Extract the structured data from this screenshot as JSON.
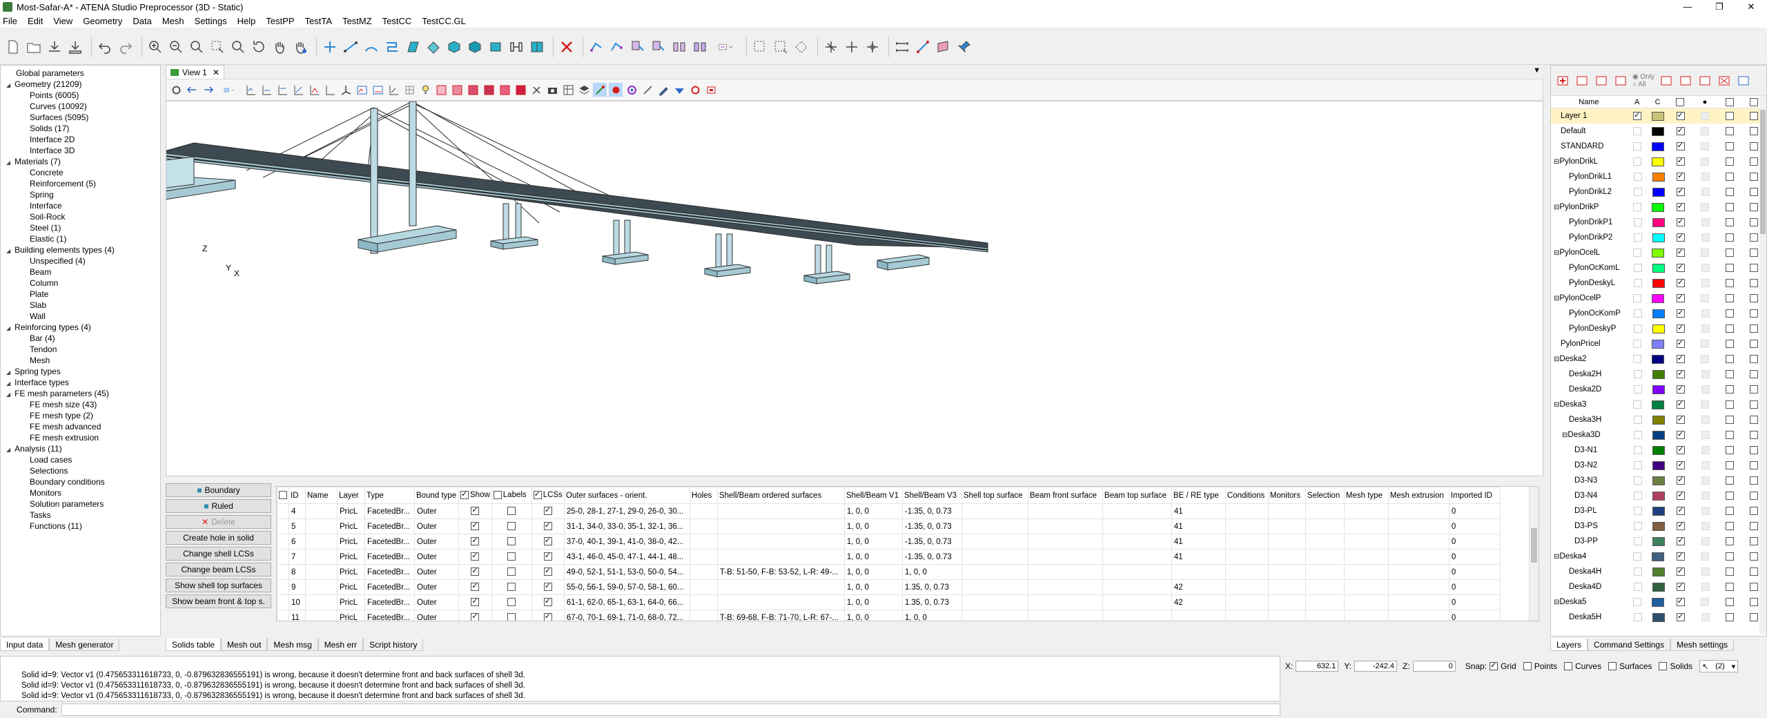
{
  "window": {
    "title": "Most-Safar-A* - ATENA Studio Preprocessor (3D - Static)"
  },
  "menu": [
    "File",
    "Edit",
    "View",
    "Geometry",
    "Data",
    "Mesh",
    "Settings",
    "Help",
    "TestPP",
    "TestTA",
    "TestMZ",
    "TestCC",
    "TestCC.GL"
  ],
  "tree": [
    {
      "label": "Global parameters",
      "level": 0,
      "exp": false
    },
    {
      "label": "Geometry (21209)",
      "level": 0,
      "exp": true
    },
    {
      "label": "Points (6005)",
      "level": 1
    },
    {
      "label": "Curves (10092)",
      "level": 1
    },
    {
      "label": "Surfaces (5095)",
      "level": 1
    },
    {
      "label": "Solids (17)",
      "level": 1
    },
    {
      "label": "Interface 2D",
      "level": 1
    },
    {
      "label": "Interface 3D",
      "level": 1
    },
    {
      "label": "Materials (7)",
      "level": 0,
      "exp": true
    },
    {
      "label": "Concrete",
      "level": 1
    },
    {
      "label": "Reinforcement (5)",
      "level": 1
    },
    {
      "label": "Spring",
      "level": 1
    },
    {
      "label": "Interface",
      "level": 1
    },
    {
      "label": "Soil-Rock",
      "level": 1
    },
    {
      "label": "Steel (1)",
      "level": 1
    },
    {
      "label": "Elastic (1)",
      "level": 1
    },
    {
      "label": "Building elements types (4)",
      "level": 0,
      "exp": true
    },
    {
      "label": "Unspecified (4)",
      "level": 1
    },
    {
      "label": "Beam",
      "level": 1
    },
    {
      "label": "Column",
      "level": 1
    },
    {
      "label": "Plate",
      "level": 1
    },
    {
      "label": "Slab",
      "level": 1
    },
    {
      "label": "Wall",
      "level": 1
    },
    {
      "label": "Reinforcing types (4)",
      "level": 0,
      "exp": true
    },
    {
      "label": "Bar (4)",
      "level": 1
    },
    {
      "label": "Tendon",
      "level": 1
    },
    {
      "label": "Mesh",
      "level": 1
    },
    {
      "label": "Spring types",
      "level": 0,
      "exp": true
    },
    {
      "label": "Interface types",
      "level": 0,
      "exp": true
    },
    {
      "label": "FE mesh parameters (45)",
      "level": 0,
      "exp": true
    },
    {
      "label": "FE mesh size (43)",
      "level": 1
    },
    {
      "label": "FE mesh type (2)",
      "level": 1
    },
    {
      "label": "FE mesh advanced",
      "level": 1
    },
    {
      "label": "FE mesh extrusion",
      "level": 1
    },
    {
      "label": "Analysis (11)",
      "level": 0,
      "exp": true
    },
    {
      "label": "Load cases",
      "level": 1
    },
    {
      "label": "Selections",
      "level": 1
    },
    {
      "label": "Boundary conditions",
      "level": 1
    },
    {
      "label": "Monitors",
      "level": 1
    },
    {
      "label": "Solution parameters",
      "level": 1
    },
    {
      "label": "Tasks",
      "level": 1
    },
    {
      "label": "Functions (11)",
      "level": 1
    }
  ],
  "left_tabs": [
    "Input data",
    "Mesh generator"
  ],
  "view": {
    "tab_label": "View 1",
    "axes": {
      "z": "Z",
      "y": "Y",
      "x": "X"
    }
  },
  "buttons": {
    "boundary": "Boundary",
    "ruled": "Ruled",
    "delete": "Delete",
    "create_hole": "Create hole in solid",
    "change_shell": "Change shell LCSs",
    "change_beam": "Change beam LCSs",
    "show_shell_top": "Show shell top surfaces",
    "show_beam_front": "Show beam front & top s."
  },
  "table": {
    "headers": [
      "ID",
      "Name",
      "Layer",
      "Type",
      "Bound type",
      "Show",
      "Labels",
      "LCSs",
      "Outer surfaces - orient.",
      "Holes",
      "Shell/Beam ordered surfaces",
      "Shell/Beam V1",
      "Shell/Beam V3",
      "Shell top surface",
      "Beam front surface",
      "Beam top surface",
      "BE / RE type",
      "Conditions",
      "Monitors",
      "Selection",
      "Mesh type",
      "Mesh extrusion",
      "Imported ID"
    ],
    "rows": [
      {
        "id": "4",
        "layer": "PricL",
        "type": "FacetedBr...",
        "bound": "Outer",
        "show": true,
        "labels": false,
        "lcs": true,
        "outer": "25-0, 28-1, 27-1, 29-0, 26-0, 30...",
        "ordered": "",
        "v1": "1, 0, 0",
        "v3": "-1.35, 0, 0.73",
        "be": "41",
        "imp": "0"
      },
      {
        "id": "5",
        "layer": "PricL",
        "type": "FacetedBr...",
        "bound": "Outer",
        "show": true,
        "labels": false,
        "lcs": true,
        "outer": "31-1, 34-0, 33-0, 35-1, 32-1, 36...",
        "ordered": "",
        "v1": "1, 0, 0",
        "v3": "-1.35, 0, 0.73",
        "be": "41",
        "imp": "0"
      },
      {
        "id": "6",
        "layer": "PricL",
        "type": "FacetedBr...",
        "bound": "Outer",
        "show": true,
        "labels": false,
        "lcs": true,
        "outer": "37-0, 40-1, 39-1, 41-0, 38-0, 42...",
        "ordered": "",
        "v1": "1, 0, 0",
        "v3": "-1.35, 0, 0.73",
        "be": "41",
        "imp": "0"
      },
      {
        "id": "7",
        "layer": "PricL",
        "type": "FacetedBr...",
        "bound": "Outer",
        "show": true,
        "labels": false,
        "lcs": true,
        "outer": "43-1, 46-0, 45-0, 47-1, 44-1, 48...",
        "ordered": "",
        "v1": "1, 0, 0",
        "v3": "-1.35, 0, 0.73",
        "be": "41",
        "imp": "0"
      },
      {
        "id": "8",
        "layer": "PricL",
        "type": "FacetedBr...",
        "bound": "Outer",
        "show": true,
        "labels": false,
        "lcs": true,
        "outer": "49-0, 52-1, 51-1, 53-0, 50-0, 54...",
        "ordered": "T-B: 51-50, F-B: 53-52, L-R: 49-...",
        "v1": "1, 0, 0",
        "v3": "1, 0, 0",
        "be": "",
        "imp": "0"
      },
      {
        "id": "9",
        "layer": "PricL",
        "type": "FacetedBr...",
        "bound": "Outer",
        "show": true,
        "labels": false,
        "lcs": true,
        "outer": "55-0, 56-1, 59-0, 57-0, 58-1, 60...",
        "ordered": "",
        "v1": "1, 0, 0",
        "v3": "1.35, 0, 0.73",
        "be": "42",
        "imp": "0"
      },
      {
        "id": "10",
        "layer": "PricL",
        "type": "FacetedBr...",
        "bound": "Outer",
        "show": true,
        "labels": false,
        "lcs": true,
        "outer": "61-1, 62-0, 65-1, 63-1, 64-0, 66...",
        "ordered": "",
        "v1": "1, 0, 0",
        "v3": "1.35, 0, 0.73",
        "be": "42",
        "imp": "0"
      },
      {
        "id": "11",
        "layer": "PricL",
        "type": "FacetedBr...",
        "bound": "Outer",
        "show": true,
        "labels": false,
        "lcs": true,
        "outer": "67-0, 70-1, 69-1, 71-0, 68-0, 72...",
        "ordered": "T-B: 69-68, F-B: 71-70, L-R: 67-...",
        "v1": "1, 0, 0",
        "v3": "1, 0, 0",
        "be": "",
        "imp": "0"
      }
    ]
  },
  "bottom_tabs": [
    "Solids table",
    "Mesh out",
    "Mesh msg",
    "Mesh err",
    "Script history"
  ],
  "layers": {
    "headers": [
      "Name",
      "A",
      "C"
    ],
    "radio_only": "Only",
    "radio_all": "All",
    "rows": [
      {
        "name": "Layer 1",
        "indent": 0,
        "active": true,
        "color": "#c8c47a",
        "sel": true
      },
      {
        "name": "Default",
        "indent": 0,
        "active": false,
        "color": "#000000"
      },
      {
        "name": "STANDARD",
        "indent": 0,
        "active": false,
        "color": "#0000ff"
      },
      {
        "name": "PylonDrikL",
        "indent": 0,
        "group": true,
        "active": false,
        "color": "#ffff00"
      },
      {
        "name": "PylonDrikL1",
        "indent": 1,
        "active": false,
        "color": "#ff8000"
      },
      {
        "name": "PylonDrikL2",
        "indent": 1,
        "active": false,
        "color": "#0000ff"
      },
      {
        "name": "PylonDrikP",
        "indent": 0,
        "group": true,
        "active": false,
        "color": "#00ff00"
      },
      {
        "name": "PylonDrikP1",
        "indent": 1,
        "active": false,
        "color": "#ff0080"
      },
      {
        "name": "PylonDrikP2",
        "indent": 1,
        "active": false,
        "color": "#00ffff"
      },
      {
        "name": "PylonOcelL",
        "indent": 0,
        "group": true,
        "active": false,
        "color": "#80ff00"
      },
      {
        "name": "PylonOcKomL",
        "indent": 1,
        "active": false,
        "color": "#00ff80"
      },
      {
        "name": "PylonDeskyL",
        "indent": 1,
        "active": false,
        "color": "#ff0000"
      },
      {
        "name": "PylonOcelP",
        "indent": 0,
        "group": true,
        "active": false,
        "color": "#ff00ff"
      },
      {
        "name": "PylonOcKomP",
        "indent": 1,
        "active": false,
        "color": "#0080ff"
      },
      {
        "name": "PylonDeskyP",
        "indent": 1,
        "active": false,
        "color": "#ffff00"
      },
      {
        "name": "PylonPricel",
        "indent": 0,
        "active": false,
        "color": "#8080ff"
      },
      {
        "name": "Deska2",
        "indent": 0,
        "group": true,
        "active": false,
        "color": "#000080"
      },
      {
        "name": "Deska2H",
        "indent": 1,
        "active": false,
        "color": "#408000"
      },
      {
        "name": "Deska2D",
        "indent": 1,
        "active": false,
        "color": "#8000ff"
      },
      {
        "name": "Deska3",
        "indent": 0,
        "group": true,
        "active": false,
        "color": "#008040"
      },
      {
        "name": "Deska3H",
        "indent": 1,
        "active": false,
        "color": "#808000"
      },
      {
        "name": "Deska3D",
        "indent": 1,
        "group": true,
        "active": false,
        "color": "#004080"
      },
      {
        "name": "D3-N1",
        "indent": 2,
        "active": false,
        "color": "#008000"
      },
      {
        "name": "D3-N2",
        "indent": 2,
        "active": false,
        "color": "#400080"
      },
      {
        "name": "D3-N3",
        "indent": 2,
        "active": false,
        "color": "#6a8040"
      },
      {
        "name": "D3-N4",
        "indent": 2,
        "active": false,
        "color": "#b04060"
      },
      {
        "name": "D3-PL",
        "indent": 2,
        "active": false,
        "color": "#204080"
      },
      {
        "name": "D3-PS",
        "indent": 2,
        "active": false,
        "color": "#806040"
      },
      {
        "name": "D3-PP",
        "indent": 2,
        "active": false,
        "color": "#408060"
      },
      {
        "name": "Deska4",
        "indent": 0,
        "group": true,
        "active": false,
        "color": "#406080"
      },
      {
        "name": "Deska4H",
        "indent": 1,
        "active": false,
        "color": "#508030"
      },
      {
        "name": "Deska4D",
        "indent": 1,
        "active": false,
        "color": "#306040"
      },
      {
        "name": "Deska5",
        "indent": 0,
        "group": true,
        "active": false,
        "color": "#2060a0"
      },
      {
        "name": "Deska5H",
        "indent": 1,
        "active": false,
        "color": "#305070"
      }
    ]
  },
  "right_tabs": [
    "Layers",
    "Command Settings",
    "Mesh settings"
  ],
  "messages": [
    "Solid id=9: Vector v1 (0.475653311618733, 0, -0.879632836555191) is wrong, because it doesn't determine front and back surfaces of shell 3d.",
    "Solid id=9: Vector v1 (0.475653311618733, 0, -0.879632836555191) is wrong, because it doesn't determine front and back surfaces of shell 3d.",
    "Solid id=9: Vector v1 (0.475653311618733, 0, -0.879632836555191) is wrong, because it doesn't determine front and back surfaces of shell 3d."
  ],
  "status": {
    "x_label": "X:",
    "x": "632.1",
    "y_label": "Y:",
    "y": "-242.4",
    "z_label": "Z:",
    "z": "0",
    "snap_label": "Snap:",
    "grid": "Grid",
    "points": "Points",
    "curves": "Curves",
    "surfaces": "Surfaces",
    "solids": "Solids",
    "selector": "(2)"
  },
  "command_label": "Command:"
}
